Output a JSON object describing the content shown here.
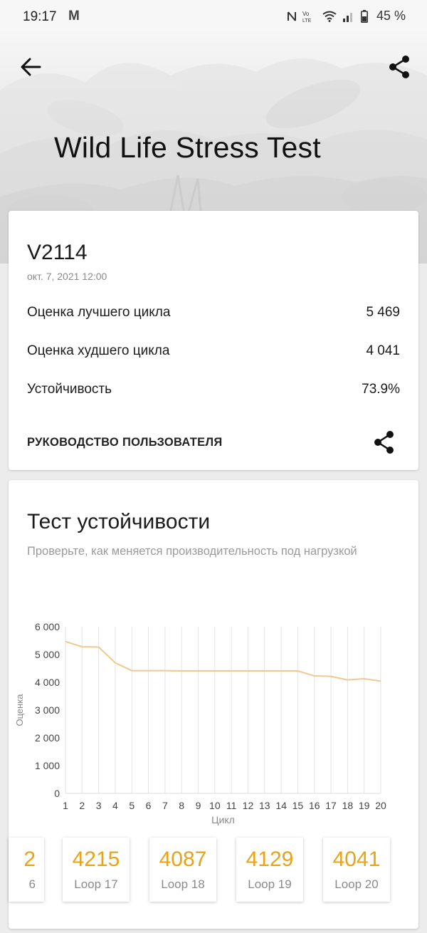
{
  "status_bar": {
    "time": "19:17",
    "mail_icon": "M",
    "battery_percent": "45 %"
  },
  "header": {
    "title": "Wild Life Stress Test",
    "icons": {
      "back": "back-arrow-icon",
      "share": "share-icon"
    }
  },
  "result": {
    "device": "V2114",
    "date": "окт. 7, 2021 12:00",
    "rows": [
      {
        "label": "Оценка лучшего цикла",
        "value": "5 469"
      },
      {
        "label": "Оценка худшего цикла",
        "value": "4 041"
      },
      {
        "label": "Устойчивость",
        "value": "73.9%"
      }
    ],
    "guide_label": "РУКОВОДСТВО ПОЛЬЗОВАТЕЛЯ"
  },
  "stability": {
    "title": "Тест устойчивости",
    "subtitle": "Проверьте, как меняется производительность под нагрузкой",
    "tiles_partial": {
      "score": "2",
      "loop": "6"
    },
    "tiles": [
      {
        "score": "4215",
        "loop": "Loop 17"
      },
      {
        "score": "4087",
        "loop": "Loop 18"
      },
      {
        "score": "4129",
        "loop": "Loop 19"
      },
      {
        "score": "4041",
        "loop": "Loop 20"
      }
    ]
  },
  "colors": {
    "accent": "#e8a317",
    "line": "#f0c890"
  },
  "chart_data": {
    "type": "line",
    "xlabel": "Цикл",
    "ylabel": "Оценка",
    "ylim": [
      0,
      6000
    ],
    "yticks": [
      "0",
      "1 000",
      "2 000",
      "3 000",
      "4 000",
      "5 000",
      "6 000"
    ],
    "x": [
      1,
      2,
      3,
      4,
      5,
      6,
      7,
      8,
      9,
      10,
      11,
      12,
      13,
      14,
      15,
      16,
      17,
      18,
      19,
      20
    ],
    "values": [
      5469,
      5280,
      5270,
      4700,
      4420,
      4420,
      4420,
      4410,
      4410,
      4410,
      4410,
      4410,
      4410,
      4410,
      4410,
      4230,
      4215,
      4087,
      4129,
      4041
    ],
    "grid": "vertical"
  }
}
